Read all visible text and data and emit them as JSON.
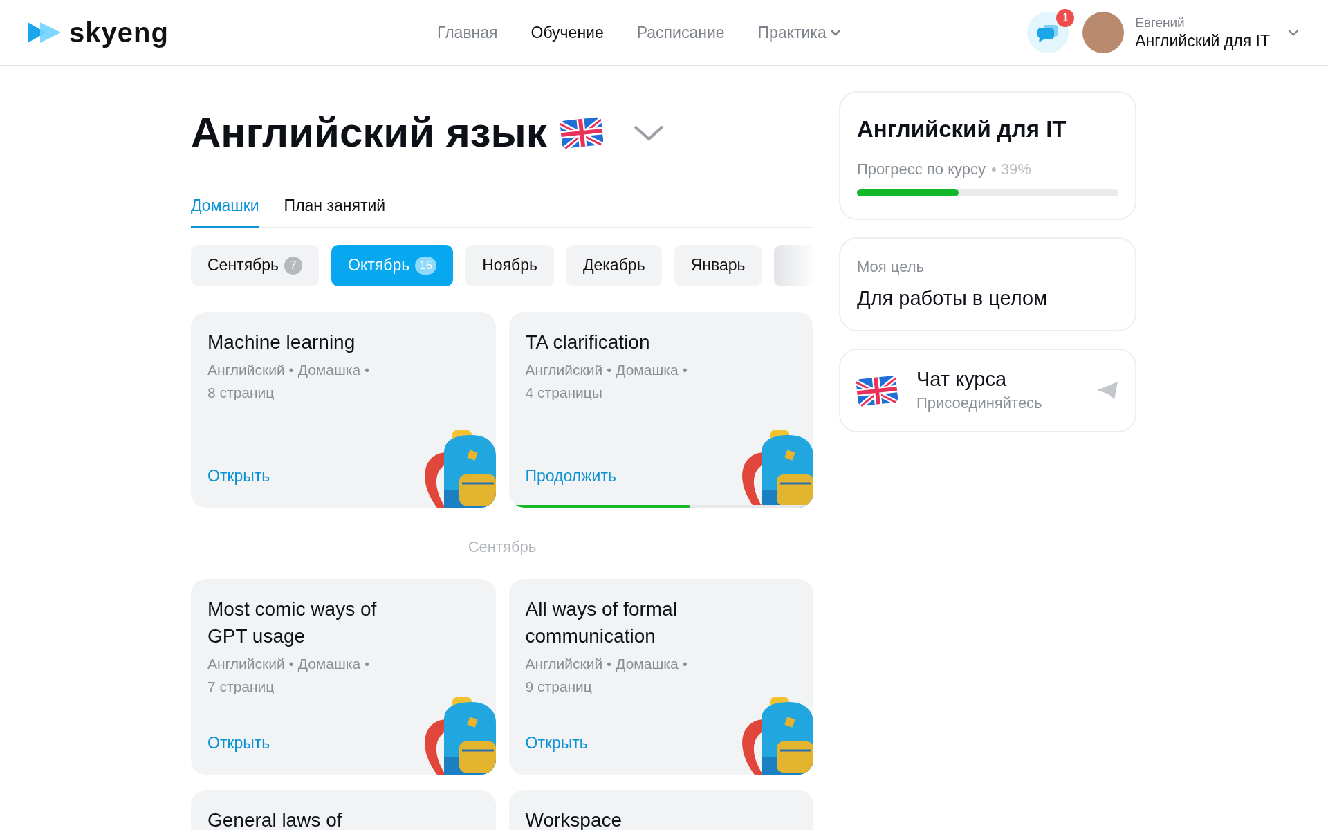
{
  "header": {
    "logo": "skyeng",
    "nav": [
      {
        "label": "Главная",
        "selected": false,
        "dropdown": false
      },
      {
        "label": "Обучение",
        "selected": true,
        "dropdown": false
      },
      {
        "label": "Расписание",
        "selected": false,
        "dropdown": false
      },
      {
        "label": "Практика",
        "selected": false,
        "dropdown": true
      }
    ],
    "chat_badge": "1",
    "user": {
      "name": "Евгений",
      "course": "Английский для IT"
    }
  },
  "title": "Английский язык",
  "tabs": [
    {
      "label": "Домашки",
      "selected": true
    },
    {
      "label": "План занятий",
      "selected": false
    }
  ],
  "months": [
    {
      "label": "Сентябрь",
      "count": "7",
      "selected": false
    },
    {
      "label": "Октябрь",
      "count": "15",
      "selected": true
    },
    {
      "label": "Ноябрь",
      "selected": false
    },
    {
      "label": "Декабрь",
      "selected": false
    },
    {
      "label": "Январь",
      "selected": false
    }
  ],
  "sections": [
    {
      "cards": [
        {
          "title": "Machine learning",
          "meta": "Английский • Домашка •",
          "pages": "8 страниц",
          "action": "Открыть"
        },
        {
          "title": "TA clarification",
          "meta": "Английский • Домашка •",
          "pages": "4 страницы",
          "action": "Продолжить",
          "level": 0.6
        }
      ]
    },
    {
      "label": "Сентябрь",
      "cards": [
        {
          "title": "Most comic ways of GPT usage",
          "meta": "Английский • Домашка •",
          "pages": "7 страниц",
          "action": "Открыть"
        },
        {
          "title": "All ways of formal communication",
          "meta": "Английский • Домашка •",
          "pages": "9 страниц",
          "action": "Открыть"
        },
        {
          "title": "General laws of"
        },
        {
          "title": "Workspace"
        }
      ]
    }
  ],
  "course": {
    "title": "Английский для IT",
    "progress_label": "Прогресс по курсу",
    "progress_value": "• 39%",
    "level": 0.39
  },
  "goal": {
    "label": "Моя цель",
    "value": "Для работы в целом"
  },
  "chat": {
    "title": "Чат курса",
    "subtitle": "Присоединяйтесь"
  }
}
